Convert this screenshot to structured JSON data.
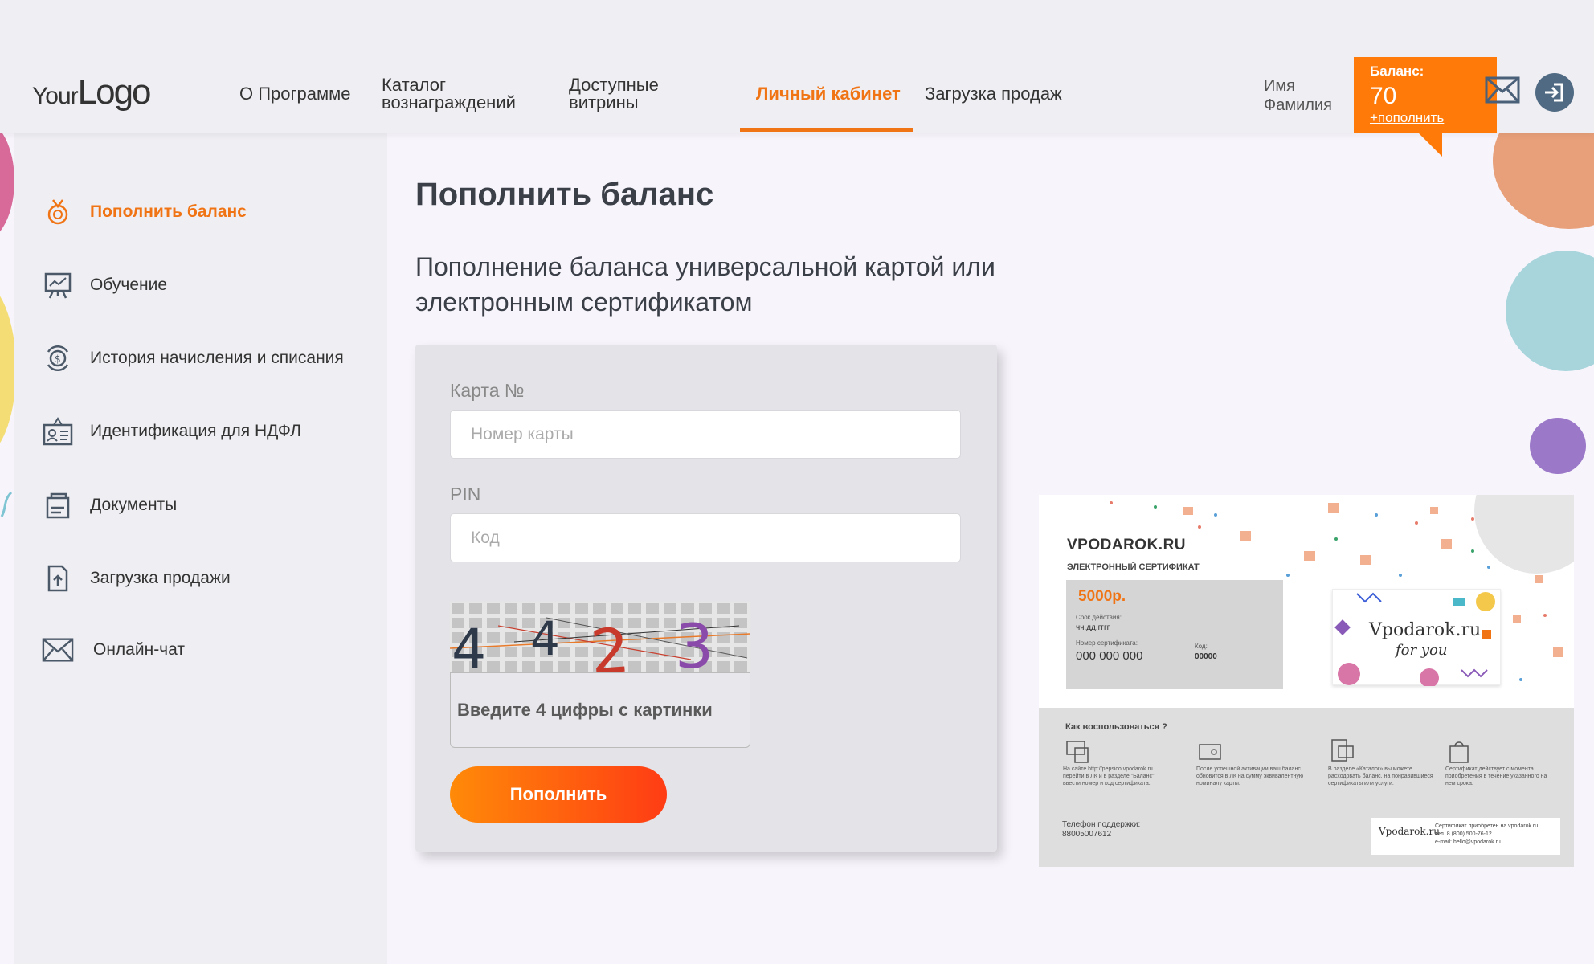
{
  "colors": {
    "accent": "#f07414",
    "balance_bg": "#ff7a08",
    "button_from": "#ff8a08",
    "button_to": "#ff3c14"
  },
  "header": {
    "logo_small": "Your",
    "logo_big": "Logo",
    "nav": [
      {
        "label": "О Программе"
      },
      {
        "label_line1": "Каталог",
        "label_line2": "вознаграждений"
      },
      {
        "label_line1": "Доступные",
        "label_line2": "витрины"
      },
      {
        "label": "Личный кабинет",
        "active": true
      },
      {
        "label": "Загрузка продаж"
      }
    ],
    "user_first": "Имя",
    "user_last": "Фамилия",
    "balance_label": "Баланс:",
    "balance_value": "70",
    "balance_topup": "+пополнить",
    "icons": [
      "mail-icon",
      "logout-icon"
    ]
  },
  "sidebar": {
    "items": [
      {
        "label": "Пополнить баланс",
        "icon": "medal-icon",
        "active": true
      },
      {
        "label": "Обучение",
        "icon": "presentation-icon"
      },
      {
        "label": "История начисления и списания",
        "icon": "coin-history-icon"
      },
      {
        "label": "Идентификация для НДФЛ",
        "icon": "id-card-icon"
      },
      {
        "label": "Документы",
        "icon": "documents-icon"
      },
      {
        "label": "Загрузка продажи",
        "icon": "upload-doc-icon"
      },
      {
        "label": "Онлайн-чат",
        "icon": "chat-mail-icon"
      }
    ]
  },
  "main": {
    "title": "Пополнить баланс",
    "subtitle": "Пополнение баланса универсальной картой или электронным сертификатом",
    "form": {
      "card_label": "Карта №",
      "card_placeholder": "Номер карты",
      "pin_label": "PIN",
      "pin_placeholder": "Код",
      "captcha_digits": [
        "4",
        "4",
        "2",
        "3"
      ],
      "captcha_placeholder": "Введите 4 цифры с картинки",
      "submit_label": "Пополнить"
    }
  },
  "certificate": {
    "brand": "VPODAROK.RU",
    "type": "ЭЛЕКТРОННЫЙ СЕРТИФИКАТ",
    "amount": "5000р.",
    "validity_label": "Срок действия:",
    "validity_value": "чч.дд.гггг",
    "number_label": "Номер сертификата:",
    "number_value": "000 000 000",
    "code_label": "Код:",
    "code_value": "00000",
    "logo_text": "Vpodarok.ru",
    "logo_sub": "for you",
    "how_title": "Как воспользоваться ?",
    "steps": [
      "На сайте http://pepsico.vpodarok.ru перейти в ЛК и в разделе \"Баланс\" ввести номер и код сертификата.",
      "После успешной активации ваш баланс обновится в ЛК на сумму эквивалентную номиналу карты.",
      "В разделе «Каталог» вы можете расходовать баланс, на понравившиеся сертификаты или услуги.",
      "Сертификат действует с момента приобретения в течение указанного на нем срока."
    ],
    "support_label": "Телефон поддержки:",
    "support_phone": "88005007612",
    "issued_line1": "Сертификат приобретен на vpodarok.ru",
    "issued_line2": "тел. 8 (800) 500-76-12",
    "issued_line3": "e-mail: hello@vpodarok.ru",
    "small_logo": "Vpodarok.ru"
  }
}
